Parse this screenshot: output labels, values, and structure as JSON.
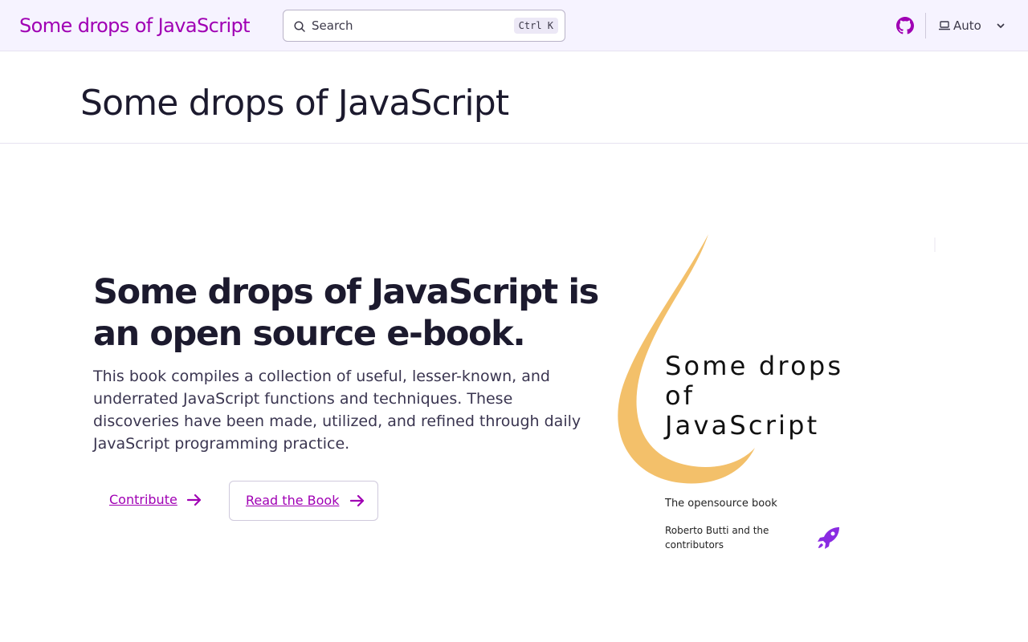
{
  "header": {
    "site_title": "Some drops of JavaScript",
    "search": {
      "placeholder": "Search",
      "shortcut": "Ctrl K"
    },
    "github_icon": "github-icon",
    "theme_selector": {
      "value": "Auto",
      "icon": "laptop-icon"
    }
  },
  "page": {
    "title": "Some drops of JavaScript"
  },
  "hero": {
    "heading": "Some drops of JavaScript is an open source e-book.",
    "description": "This book compiles a collection of useful, lesser-known, and underrated JavaScript functions and techniques. These discoveries have been made, utilized, and refined through daily JavaScript programming practice.",
    "buttons": [
      {
        "label": "Contribute",
        "icon": "arrow-right-icon"
      },
      {
        "label": "Read the Book",
        "icon": "arrow-right-icon"
      }
    ]
  },
  "cover": {
    "title": "Some drops of JavaScript",
    "subtitle": "The opensource book",
    "authors": "Roberto Butti and the contributors",
    "icon": "rocket-icon"
  },
  "colors": {
    "accent": "#a000b4",
    "header_bg": "#f6f3ff",
    "drop": "#f3c06a",
    "text": "#1c1a2e"
  }
}
